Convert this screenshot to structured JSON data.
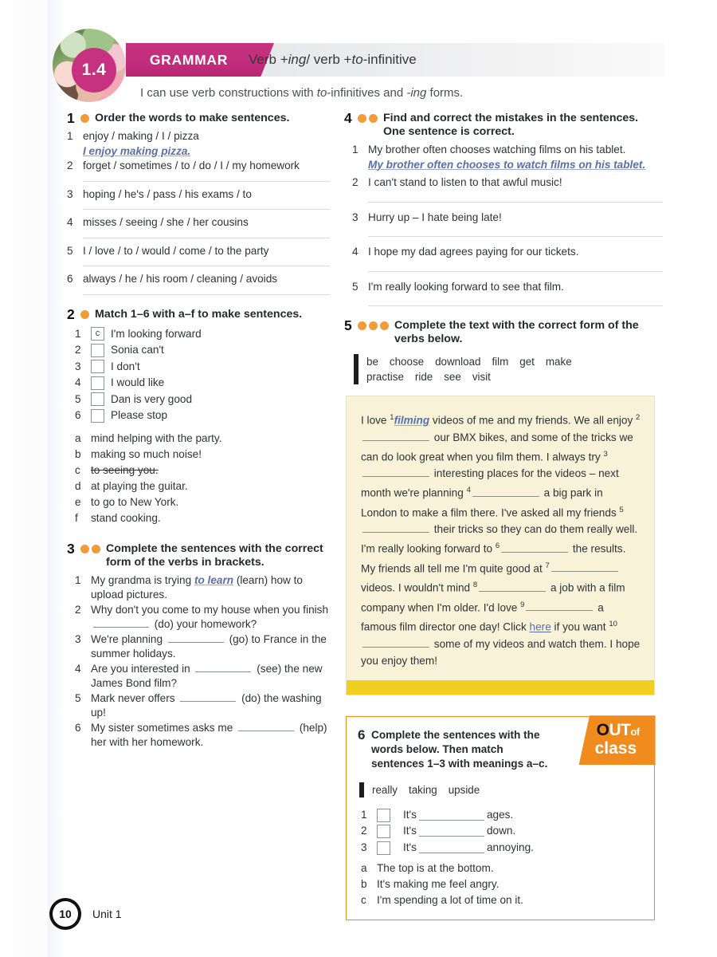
{
  "header": {
    "unit_number": "1.4",
    "section_label": "GRAMMAR",
    "title_part1": "Verb + ",
    "title_ing": "ing",
    "title_part2": " / verb + ",
    "title_to": "to",
    "title_part3": "-infinitive",
    "can_do_1": "I can use verb constructions with ",
    "can_do_to": "to",
    "can_do_2": "-infinitives and ",
    "can_do_ing": "-ing",
    "can_do_3": " forms.",
    "accent_pink": "#c6327f",
    "accent_orange": "#f49b33"
  },
  "ex1": {
    "number": "1",
    "difficulty_dots": 1,
    "instruction": "Order the words to make sentences.",
    "items": [
      {
        "label": "1",
        "prompt": "enjoy / making / I / pizza",
        "answer": "I enjoy making pizza.",
        "has_line": false
      },
      {
        "label": "2",
        "prompt": "forget / sometimes / to / do / I / my homework",
        "answer": "",
        "has_line": true
      },
      {
        "label": "3",
        "prompt": "hoping / he's / pass / his exams / to",
        "answer": "",
        "has_line": true
      },
      {
        "label": "4",
        "prompt": "misses / seeing / she / her cousins",
        "answer": "",
        "has_line": true
      },
      {
        "label": "5",
        "prompt": "I / love / to / would / come / to the party",
        "answer": "",
        "has_line": true
      },
      {
        "label": "6",
        "prompt": "always / he / his room / cleaning / avoids",
        "answer": "",
        "has_line": true
      }
    ]
  },
  "ex2": {
    "number": "2",
    "difficulty_dots": 1,
    "instruction": "Match 1–6 with a–f to make sentences.",
    "matches": [
      {
        "label": "1",
        "box": "c",
        "text": "I'm looking forward"
      },
      {
        "label": "2",
        "box": "",
        "text": "Sonia can't"
      },
      {
        "label": "3",
        "box": "",
        "text": "I don't"
      },
      {
        "label": "4",
        "box": "",
        "text": "I would like"
      },
      {
        "label": "5",
        "box": "",
        "text": "Dan is very good"
      },
      {
        "label": "6",
        "box": "",
        "text": "Please stop"
      }
    ],
    "options": [
      {
        "label": "a",
        "text": "mind helping with the party.",
        "used": false
      },
      {
        "label": "b",
        "text": "making so much noise!",
        "used": false
      },
      {
        "label": "c",
        "text": "to seeing you.",
        "used": true
      },
      {
        "label": "d",
        "text": "at playing the guitar.",
        "used": false
      },
      {
        "label": "e",
        "text": "to go to New York.",
        "used": false
      },
      {
        "label": "f",
        "text": "stand cooking.",
        "used": false
      }
    ]
  },
  "ex3": {
    "number": "3",
    "difficulty_dots": 2,
    "instruction": "Complete the sentences with the correct form of the verbs in brackets.",
    "items": [
      {
        "label": "1",
        "pre": "My grandma is trying ",
        "answer": "to learn",
        "post": " (learn) how to upload pictures."
      },
      {
        "label": "2",
        "pre": "Why don't you come to my house when you finish ",
        "answer": "",
        "post": " (do) your homework?"
      },
      {
        "label": "3",
        "pre": "We're planning ",
        "answer": "",
        "post": " (go) to France in the summer holidays."
      },
      {
        "label": "4",
        "pre": "Are you interested in ",
        "answer": "",
        "post": " (see) the new James Bond film?"
      },
      {
        "label": "5",
        "pre": "Mark never offers ",
        "answer": "",
        "post": " (do) the washing up!"
      },
      {
        "label": "6",
        "pre": "My sister sometimes asks me ",
        "answer": "",
        "post": " (help) her with her homework."
      }
    ]
  },
  "ex4": {
    "number": "4",
    "difficulty_dots": 2,
    "instruction": "Find and correct the mistakes in the sentences. One sentence is correct.",
    "items": [
      {
        "label": "1",
        "prompt": "My brother often chooses watching films on his tablet.",
        "answer": "My brother often chooses to watch films on his tablet.",
        "has_line": false
      },
      {
        "label": "2",
        "prompt": "I can't stand to listen to that awful music!",
        "answer": "",
        "has_line": true
      },
      {
        "label": "3",
        "prompt": "Hurry up – I hate being late!",
        "answer": "",
        "has_line": true
      },
      {
        "label": "4",
        "prompt": "I hope my dad agrees paying for our tickets.",
        "answer": "",
        "has_line": true
      },
      {
        "label": "5",
        "prompt": "I'm really looking forward to see that film.",
        "answer": "",
        "has_line": true
      }
    ]
  },
  "ex5": {
    "number": "5",
    "difficulty_dots": 3,
    "instruction": "Complete the text with the correct form of the verbs below.",
    "wordbank": [
      "be",
      "choose",
      "download",
      "film",
      "get",
      "make",
      "practise",
      "ride",
      "see",
      "visit"
    ],
    "text_segments": [
      {
        "type": "text",
        "value": "I love "
      },
      {
        "type": "sup",
        "value": "1"
      },
      {
        "type": "answer",
        "value": "filming"
      },
      {
        "type": "text",
        "value": " videos of me and my friends. We all enjoy "
      },
      {
        "type": "sup",
        "value": "2"
      },
      {
        "type": "gap",
        "value": ""
      },
      {
        "type": "text",
        "value": " our BMX bikes, and some of the tricks we can do look great when you film them. I always try "
      },
      {
        "type": "sup",
        "value": "3"
      },
      {
        "type": "gap",
        "value": ""
      },
      {
        "type": "text",
        "value": " interesting places for the videos – next month we're planning "
      },
      {
        "type": "sup",
        "value": "4"
      },
      {
        "type": "gap",
        "value": ""
      },
      {
        "type": "text",
        "value": " a big park in London to make a film there. I've asked all my friends "
      },
      {
        "type": "sup",
        "value": "5"
      },
      {
        "type": "gap",
        "value": ""
      },
      {
        "type": "text",
        "value": " their tricks so they can do them really well. I'm really looking forward to "
      },
      {
        "type": "sup",
        "value": "6"
      },
      {
        "type": "gap",
        "value": ""
      },
      {
        "type": "text",
        "value": " the results. My friends all tell me I'm quite good at "
      },
      {
        "type": "sup",
        "value": "7"
      },
      {
        "type": "gap",
        "value": ""
      },
      {
        "type": "text",
        "value": " videos. I wouldn't mind "
      },
      {
        "type": "sup",
        "value": "8"
      },
      {
        "type": "gap",
        "value": ""
      },
      {
        "type": "text",
        "value": " a job with a film company when I'm older. I'd love "
      },
      {
        "type": "sup",
        "value": "9"
      },
      {
        "type": "gap",
        "value": ""
      },
      {
        "type": "text",
        "value": " a famous film director one day! Click "
      },
      {
        "type": "link",
        "value": "here"
      },
      {
        "type": "text",
        "value": " if you want "
      },
      {
        "type": "sup",
        "value": "10"
      },
      {
        "type": "gap",
        "value": ""
      },
      {
        "type": "text",
        "value": " some of my videos and watch them. I hope you enjoy them!"
      }
    ]
  },
  "ex6": {
    "number": "6",
    "badge_line1_o": "O",
    "badge_line1_ut": "UT",
    "badge_line1_of": "of",
    "badge_line2": "class",
    "instruction": "Complete the sentences with the words below. Then match sentences 1–3 with meanings a–c.",
    "wordbank": [
      "really",
      "taking",
      "upside"
    ],
    "sentences": [
      {
        "label": "1",
        "box": "",
        "pre": "It's",
        "post": "ages."
      },
      {
        "label": "2",
        "box": "",
        "pre": "It's",
        "post": "down."
      },
      {
        "label": "3",
        "box": "",
        "pre": "It's",
        "post": "annoying."
      }
    ],
    "meanings": [
      {
        "label": "a",
        "text": "The top is at the bottom."
      },
      {
        "label": "b",
        "text": "It's making me feel angry."
      },
      {
        "label": "c",
        "text": "I'm spending a lot of time on it."
      }
    ]
  },
  "footer": {
    "page_number": "10",
    "unit": "Unit 1"
  }
}
